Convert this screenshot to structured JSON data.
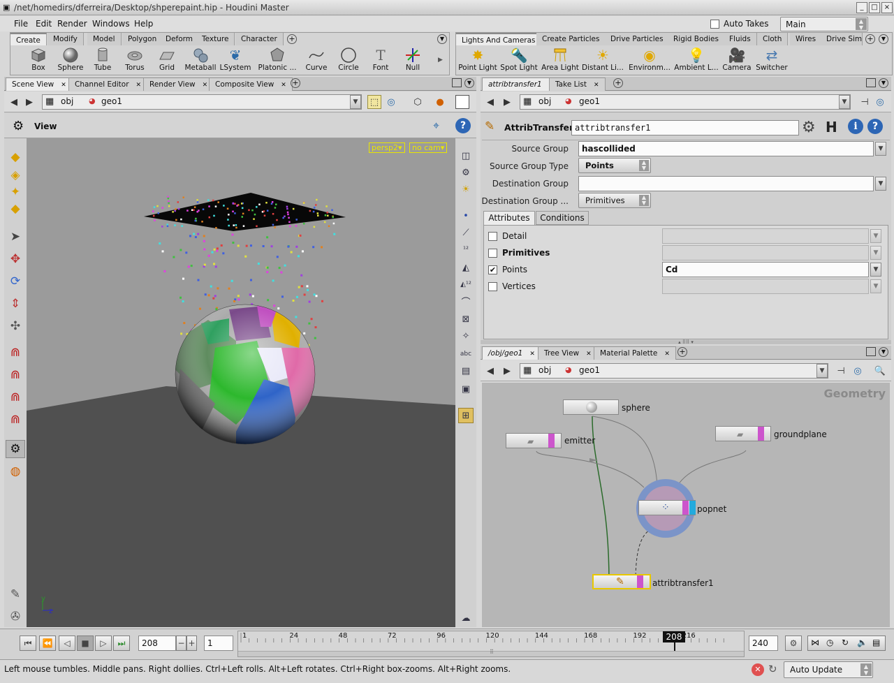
{
  "window": {
    "title": "/net/homedirs/dferreira/Desktop/shperepaint.hip - Houdini Master"
  },
  "menu": {
    "items": [
      "File",
      "Edit",
      "Render",
      "Windows",
      "Help"
    ],
    "auto_takes_label": "Auto Takes",
    "auto_takes_checked": false,
    "desktop": "Main"
  },
  "shelf_left": {
    "tabs": [
      "Create",
      "Modify",
      "Model",
      "Polygon",
      "Deform",
      "Texture",
      "Character"
    ],
    "active_tab": "Create",
    "tools": [
      {
        "label": "Box",
        "icon": "box-icon"
      },
      {
        "label": "Sphere",
        "icon": "sphere-icon"
      },
      {
        "label": "Tube",
        "icon": "tube-icon"
      },
      {
        "label": "Torus",
        "icon": "torus-icon"
      },
      {
        "label": "Grid",
        "icon": "grid-icon"
      },
      {
        "label": "Metaball",
        "icon": "metaball-icon"
      },
      {
        "label": "LSystem",
        "icon": "lsystem-icon"
      },
      {
        "label": "Platonic ...",
        "icon": "platonic-icon"
      },
      {
        "label": "Curve",
        "icon": "curve-icon"
      },
      {
        "label": "Circle",
        "icon": "circle-icon"
      },
      {
        "label": "Font",
        "icon": "font-icon"
      },
      {
        "label": "Null",
        "icon": "null-icon"
      }
    ]
  },
  "shelf_right": {
    "tabs": [
      "Lights And Cameras",
      "Create Particles",
      "Drive Particles",
      "Rigid Bodies",
      "Fluids",
      "Cloth",
      "Wires",
      "Drive Simu"
    ],
    "active_tab": "Lights And Cameras",
    "tools": [
      {
        "label": "Point Light",
        "icon": "point-light-icon"
      },
      {
        "label": "Spot Light",
        "icon": "spot-light-icon"
      },
      {
        "label": "Area Light",
        "icon": "area-light-icon"
      },
      {
        "label": "Distant Li...",
        "icon": "distant-light-icon"
      },
      {
        "label": "Environm...",
        "icon": "environment-light-icon"
      },
      {
        "label": "Ambient L...",
        "icon": "ambient-light-icon"
      },
      {
        "label": "Camera",
        "icon": "camera-icon"
      },
      {
        "label": "Switcher",
        "icon": "switcher-icon"
      }
    ]
  },
  "scene_pane": {
    "tabs": [
      "Scene View",
      "Channel Editor",
      "Render View",
      "Composite View"
    ],
    "active_tab": "Scene View",
    "path": [
      "obj",
      "geo1"
    ],
    "view_label": "View",
    "camera_tag": "persp2▾",
    "cam_tag": "no cam▾",
    "axis_y": "y",
    "axis_z": "z"
  },
  "param_pane": {
    "tabs": [
      "attribtransfer1",
      "Take List"
    ],
    "active_tab": "attribtransfer1",
    "path": [
      "obj",
      "geo1"
    ],
    "node_type": "AttribTransfer",
    "node_name": "attribtransfer1",
    "source_group_label": "Source Group",
    "source_group": "hascollided",
    "source_group_type_label": "Source Group Type",
    "source_group_type": "Points",
    "dest_group_label": "Destination Group",
    "dest_group": "",
    "dest_group_type_label": "Destination Group ...",
    "dest_group_type": "Primitives",
    "subtabs": [
      "Attributes",
      "Conditions"
    ],
    "active_subtab": "Attributes",
    "attributes": [
      {
        "label": "Detail",
        "checked": false,
        "value": ""
      },
      {
        "label": "Primitives",
        "checked": false,
        "value": ""
      },
      {
        "label": "Points",
        "checked": true,
        "value": "Cd"
      },
      {
        "label": "Vertices",
        "checked": false,
        "value": ""
      }
    ]
  },
  "network_pane": {
    "tabs": [
      "/obj/geo1",
      "Tree View",
      "Material Palette"
    ],
    "active_tab": "/obj/geo1",
    "path": [
      "obj",
      "geo1"
    ],
    "context_label": "Geometry",
    "nodes": [
      {
        "name": "sphere"
      },
      {
        "name": "emitter"
      },
      {
        "name": "groundplane"
      },
      {
        "name": "popnet"
      },
      {
        "name": "attribtransfer1"
      }
    ]
  },
  "timeline": {
    "current_frame": "208",
    "start_frame": "1",
    "end_frame": "240",
    "ticks": [
      "1",
      "24",
      "48",
      "72",
      "96",
      "120",
      "144",
      "168",
      "192",
      "216"
    ],
    "playhead_label": "208"
  },
  "status": {
    "message": "Left mouse tumbles. Middle pans. Right dollies. Ctrl+Left rolls. Alt+Left rotates. Ctrl+Right box-zooms. Alt+Right zooms.",
    "update_mode": "Auto Update"
  }
}
